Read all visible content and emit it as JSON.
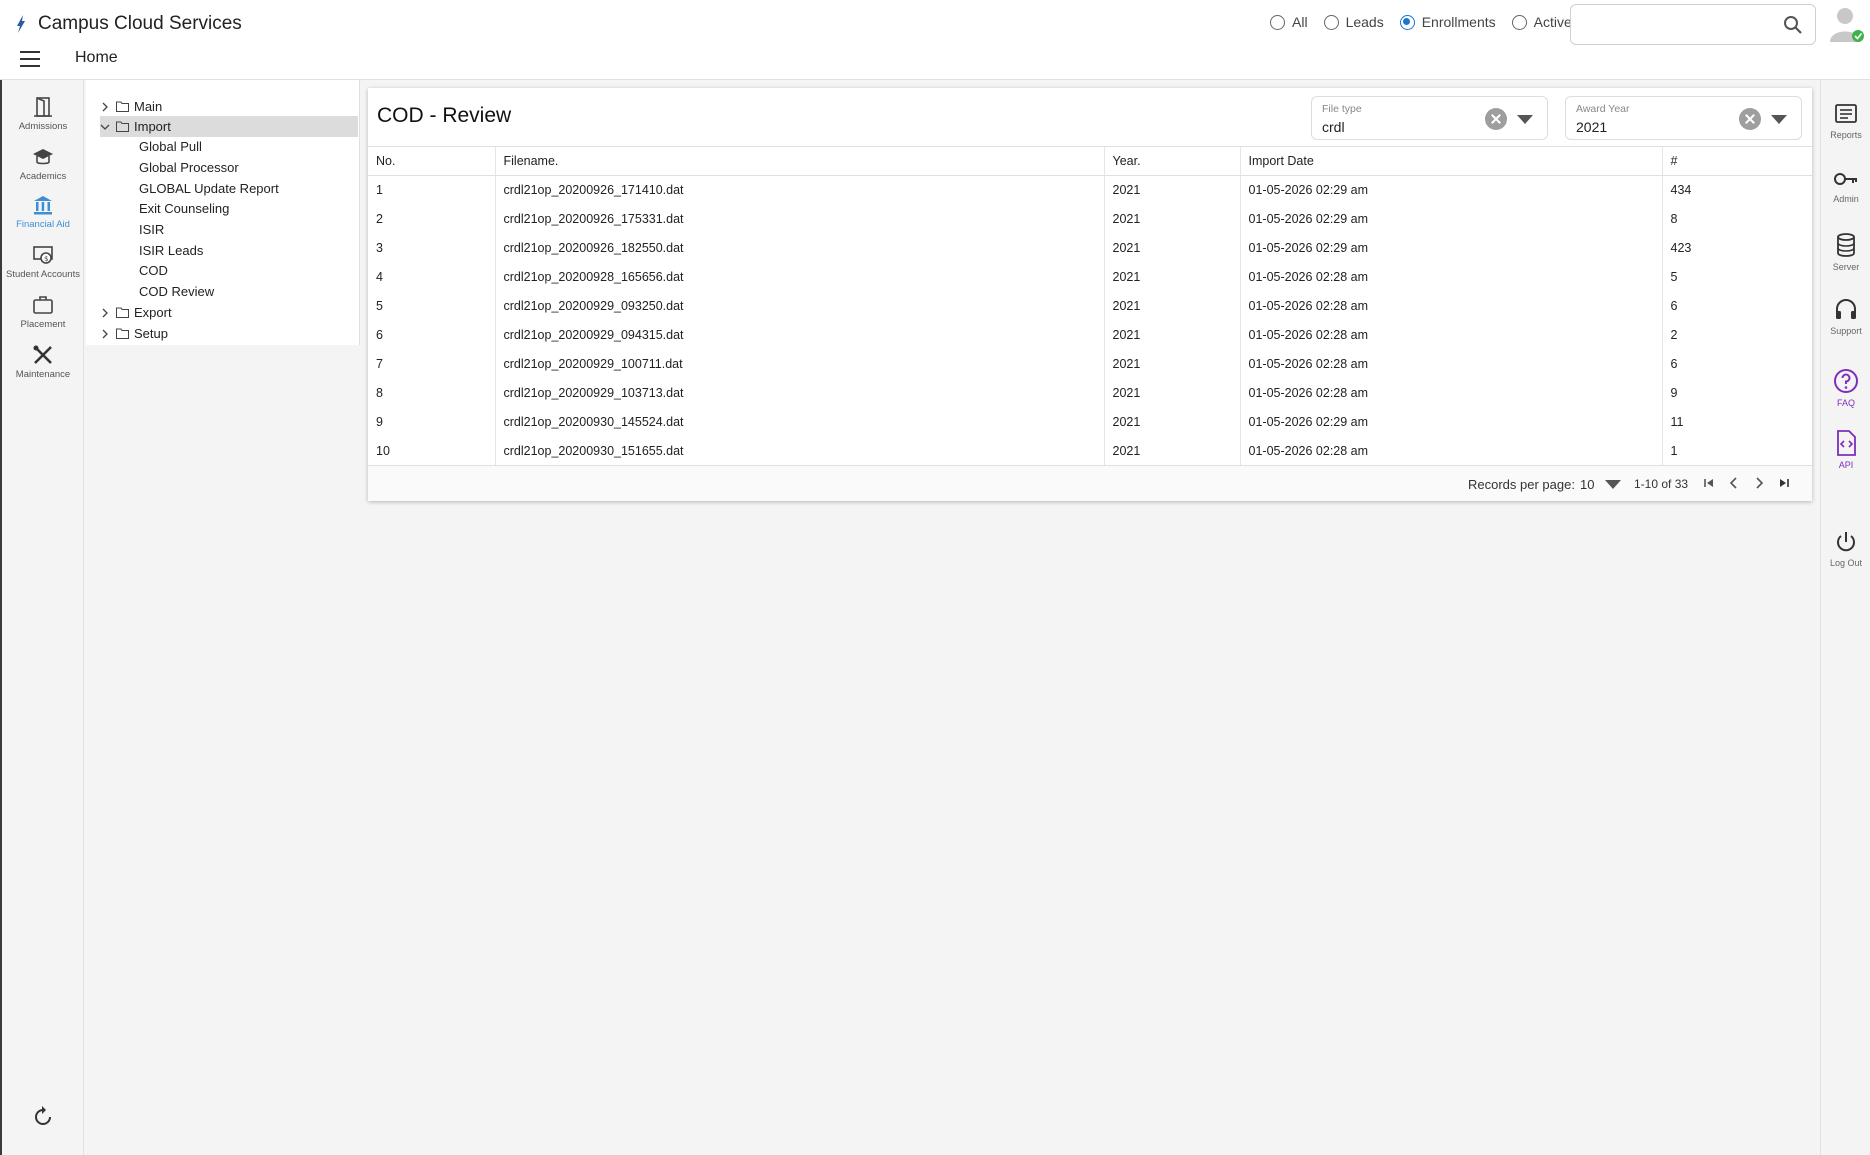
{
  "app": {
    "title": "Campus Cloud Services"
  },
  "header": {
    "home_label": "Home",
    "filters": [
      {
        "label": "All",
        "checked": false
      },
      {
        "label": "Leads",
        "checked": false
      },
      {
        "label": "Enrollments",
        "checked": true
      },
      {
        "label": "Active",
        "checked": false
      }
    ],
    "search_value": ""
  },
  "leftnav": {
    "items": [
      {
        "label": "Admissions",
        "icon": "door-icon",
        "active": false
      },
      {
        "label": "Academics",
        "icon": "graduation-cap-icon",
        "active": false
      },
      {
        "label": "Financial Aid",
        "icon": "bank-icon",
        "active": true
      },
      {
        "label": "Student Accounts",
        "icon": "money-icon",
        "active": false
      },
      {
        "label": "Placement",
        "icon": "briefcase-icon",
        "active": false
      },
      {
        "label": "Maintenance",
        "icon": "tools-icon",
        "active": false
      }
    ]
  },
  "tree": {
    "main": "Main",
    "import": "Import",
    "import_children": [
      "Global Pull",
      "Global Processor",
      "GLOBAL Update Report",
      "Exit Counseling",
      "ISIR",
      "ISIR Leads",
      "COD",
      "COD Review"
    ],
    "export": "Export",
    "setup": "Setup"
  },
  "card": {
    "title": "COD - Review",
    "file_type": {
      "label": "File type",
      "value": "crdl"
    },
    "award_year": {
      "label": "Award Year",
      "value": "2021"
    }
  },
  "table": {
    "headers": [
      "No.",
      "Filename.",
      "Year.",
      "Import Date",
      "#"
    ],
    "rows": [
      [
        "1",
        "crdl21op_20200926_171410.dat",
        "2021",
        "01-05-2026 02:29 am",
        "434"
      ],
      [
        "2",
        "crdl21op_20200926_175331.dat",
        "2021",
        "01-05-2026 02:29 am",
        "8"
      ],
      [
        "3",
        "crdl21op_20200926_182550.dat",
        "2021",
        "01-05-2026 02:29 am",
        "423"
      ],
      [
        "4",
        "crdl21op_20200928_165656.dat",
        "2021",
        "01-05-2026 02:28 am",
        "5"
      ],
      [
        "5",
        "crdl21op_20200929_093250.dat",
        "2021",
        "01-05-2026 02:28 am",
        "6"
      ],
      [
        "6",
        "crdl21op_20200929_094315.dat",
        "2021",
        "01-05-2026 02:28 am",
        "2"
      ],
      [
        "7",
        "crdl21op_20200929_100711.dat",
        "2021",
        "01-05-2026 02:28 am",
        "6"
      ],
      [
        "8",
        "crdl21op_20200929_103713.dat",
        "2021",
        "01-05-2026 02:28 am",
        "9"
      ],
      [
        "9",
        "crdl21op_20200930_145524.dat",
        "2021",
        "01-05-2026 02:29 am",
        "11"
      ],
      [
        "10",
        "crdl21op_20200930_151655.dat",
        "2021",
        "01-05-2026 02:28 am",
        "1"
      ]
    ]
  },
  "pager": {
    "records_per_page_label": "Records per page:",
    "records_per_page": "10",
    "range": "1-10 of 33"
  },
  "rightrail": {
    "items": [
      {
        "label": "Reports",
        "icon": "reports-icon"
      },
      {
        "label": "Admin",
        "icon": "key-icon"
      },
      {
        "label": "Server",
        "icon": "database-icon"
      },
      {
        "label": "Support",
        "icon": "headset-icon"
      },
      {
        "label": "FAQ",
        "icon": "help-icon"
      },
      {
        "label": "API",
        "icon": "code-file-icon"
      },
      {
        "label": "Log Out",
        "icon": "power-icon"
      }
    ]
  },
  "colors": {
    "accent": "#1976d2",
    "active_nav": "#3d8ed9",
    "purple": "#7b2fbf"
  }
}
